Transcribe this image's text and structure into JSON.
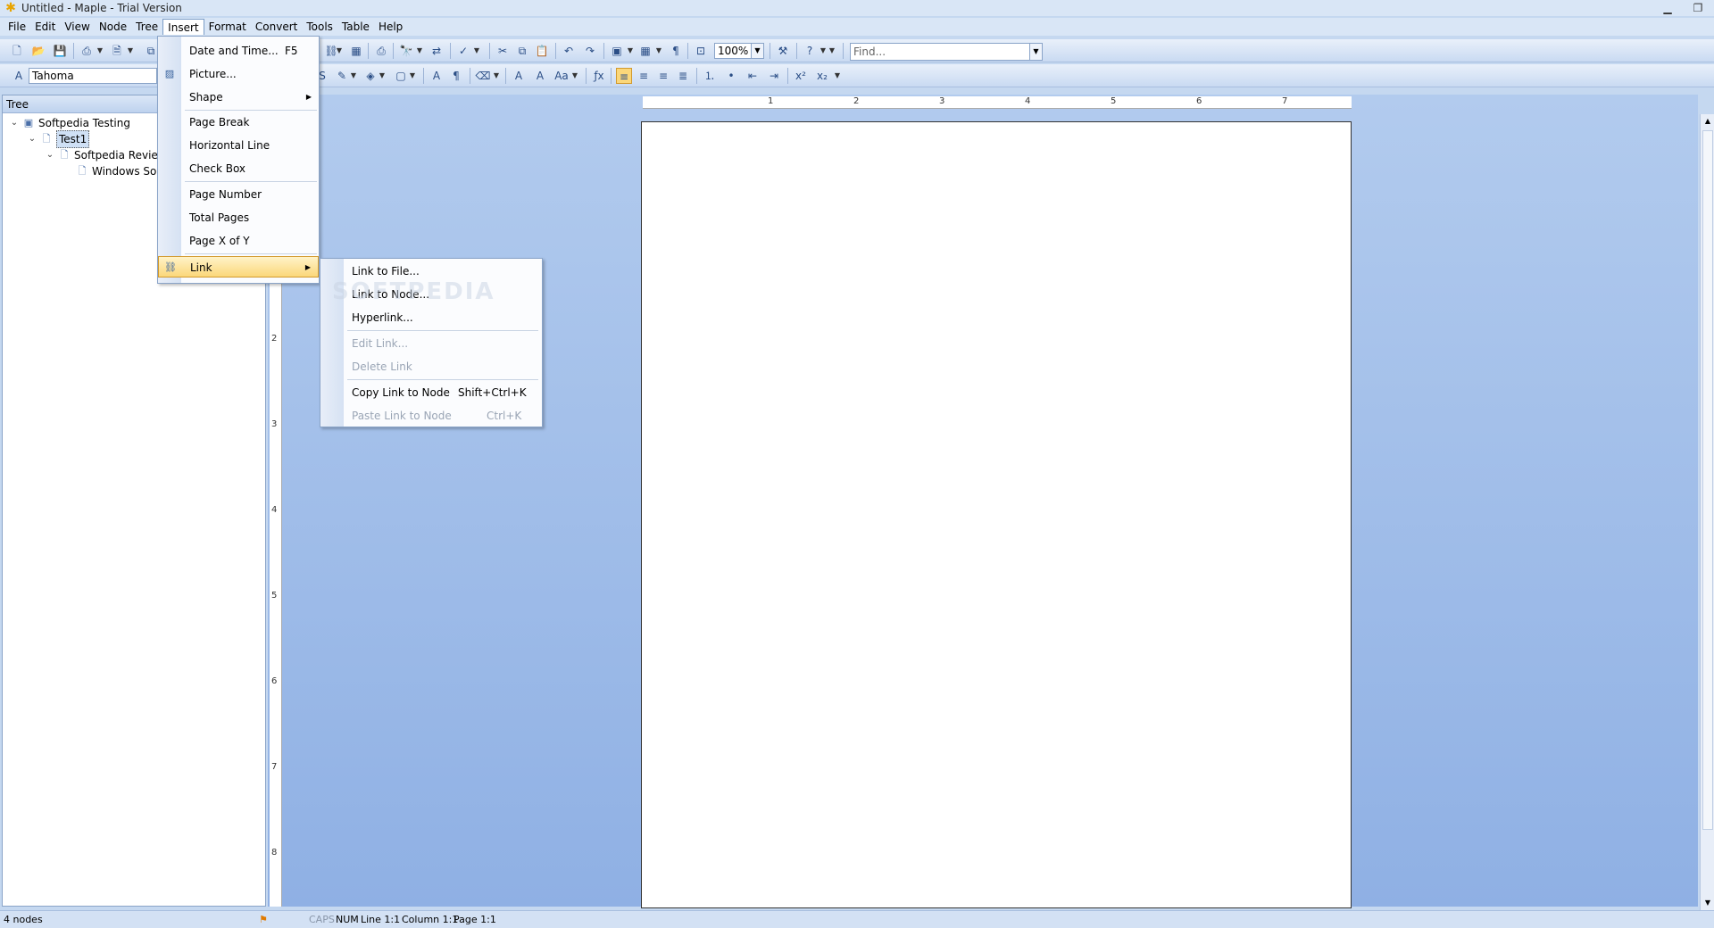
{
  "window": {
    "title": "Untitled - Maple - Trial Version",
    "controls": [
      "minimize-icon",
      "restore-icon"
    ]
  },
  "menubar": [
    "File",
    "Edit",
    "View",
    "Node",
    "Tree",
    "Insert",
    "Format",
    "Convert",
    "Tools",
    "Table",
    "Help"
  ],
  "toolbar": {
    "zoom": "100%",
    "find_placeholder": "Find...",
    "font": "Tahoma"
  },
  "tree": {
    "header": "Tree",
    "nodes": [
      {
        "label": "Softpedia Testing"
      },
      {
        "label": "Test1"
      },
      {
        "label": "Softpedia Revie"
      },
      {
        "label": "Windows So"
      }
    ]
  },
  "insert_menu": {
    "items": [
      {
        "label": "Date and Time...",
        "shortcut": "F5"
      },
      {
        "label": "Picture..."
      },
      {
        "label": "Shape"
      },
      {
        "label": "Page Break"
      },
      {
        "label": "Horizontal Line"
      },
      {
        "label": "Check Box"
      },
      {
        "label": "Page Number"
      },
      {
        "label": "Total Pages"
      },
      {
        "label": "Page X of Y"
      },
      {
        "label": "Link"
      }
    ]
  },
  "link_menu": {
    "items": [
      {
        "label": "Link to File..."
      },
      {
        "label": "Link to Node..."
      },
      {
        "label": "Hyperlink..."
      },
      {
        "label": "Edit Link..."
      },
      {
        "label": "Delete Link"
      },
      {
        "label": "Copy Link to Node",
        "shortcut": "Shift+Ctrl+K"
      },
      {
        "label": "Paste Link to Node",
        "shortcut": "Ctrl+K"
      }
    ]
  },
  "ruler": {
    "h_numbers": [
      "1",
      "2",
      "3",
      "4",
      "5",
      "6",
      "7"
    ],
    "v_numbers": [
      "2",
      "3",
      "4",
      "5",
      "6",
      "7",
      "8"
    ]
  },
  "status": {
    "nodes": "4 nodes",
    "caps": "CAPS",
    "num": "NUM",
    "line": "Line 1:1",
    "column": "Column 1:1",
    "page": "Page 1:1"
  },
  "watermark": "SOFTPEDIA"
}
